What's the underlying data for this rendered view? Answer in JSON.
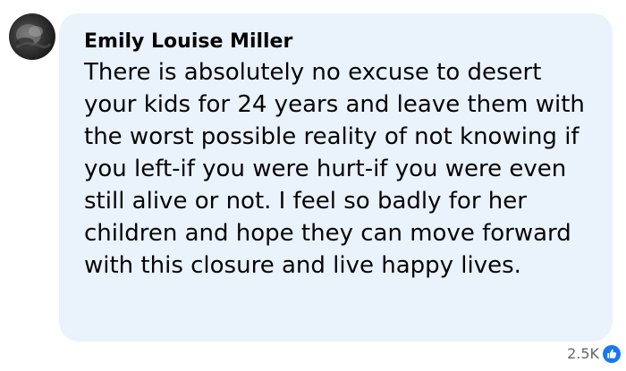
{
  "comment": {
    "author": "Emily Louise Miller",
    "text": "There is absolutely no excuse to desert your kids for 24 years and leave them with the worst possible reality of not knowing if you left-if you were hurt-if you were even still alive or not. I feel so badly for her children and hope they can move forward with this closure and live happy lives.",
    "reaction_count": "2.5K",
    "reaction_icon": "like-icon",
    "colors": {
      "bubble": "#eaf2fc",
      "like": "#1877f2",
      "count": "#65676b"
    }
  }
}
